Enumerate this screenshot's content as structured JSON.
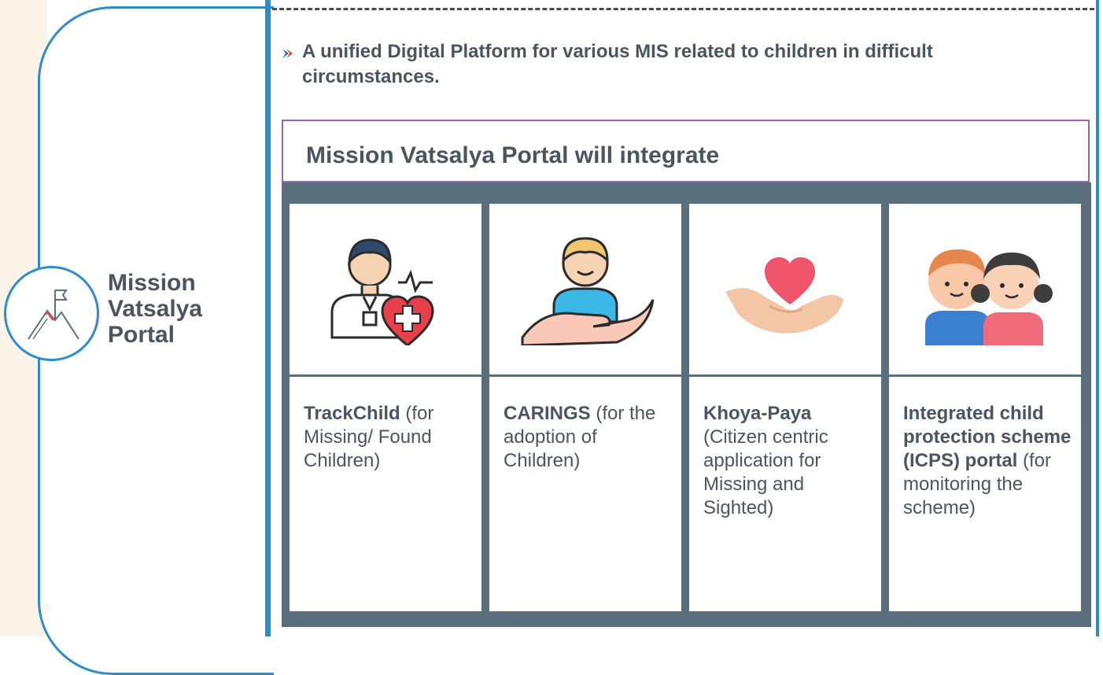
{
  "portal": {
    "title_lines": [
      "Mission",
      "Vatsalya",
      "Portal"
    ],
    "icon": "mountain-flag-icon"
  },
  "intro": {
    "bullet_icon": "chevron-right-icon",
    "text": "A unified Digital Platform for various MIS related to children in difficult circumstances."
  },
  "panel": {
    "heading": "Mission Vatsalya Portal will integrate"
  },
  "cards": [
    {
      "icon": "doctor-heart-icon",
      "title": "TrackChild",
      "description": " (for Missing/ Found Children)"
    },
    {
      "icon": "hand-holding-child-icon",
      "title": "CARINGS",
      "description": " (for the adoption of Children)"
    },
    {
      "icon": "hand-holding-heart-icon",
      "title": "Khoya-Paya",
      "description": " (Citizen centric application for Missing and Sighted)"
    },
    {
      "icon": "children-icon",
      "title": "Integrated child protection scheme (ICPS) portal",
      "description": " (for monitoring the scheme)"
    }
  ],
  "colors": {
    "accent_blue": "#2d8ccd",
    "panel_purple": "#9a62b5",
    "slate": "#5b6e7c",
    "text": "#4a5560",
    "side_tint": "#fdf4e9"
  }
}
